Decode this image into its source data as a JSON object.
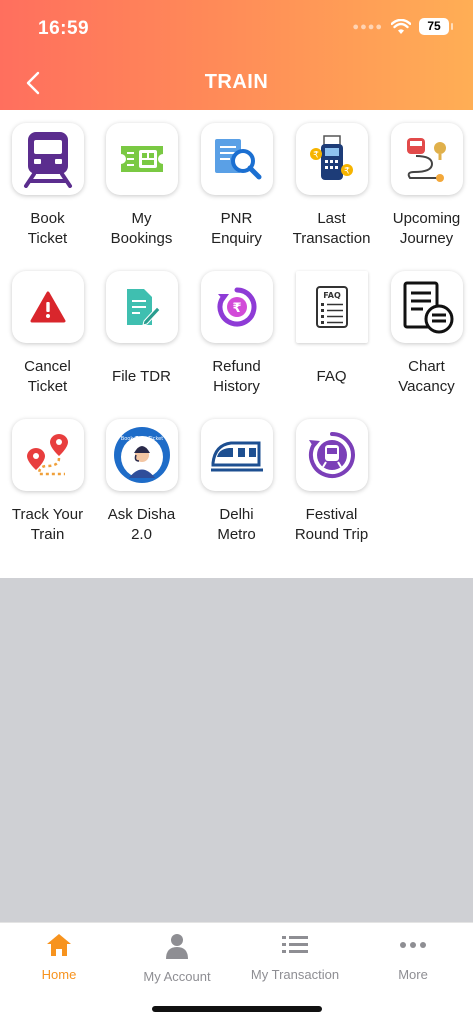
{
  "status_bar": {
    "time": "16:59",
    "battery": "75"
  },
  "header": {
    "title": "TRAIN"
  },
  "tiles": [
    {
      "label": "Book\nTicket",
      "icon": "train-front-icon"
    },
    {
      "label": "My\nBookings",
      "icon": "ticket-icon"
    },
    {
      "label": "PNR\nEnquiry",
      "icon": "pnr-search-icon"
    },
    {
      "label": "Last\nTransaction",
      "icon": "card-machine-icon"
    },
    {
      "label": "Upcoming\nJourney",
      "icon": "route-icon"
    },
    {
      "label": "Cancel\nTicket",
      "icon": "warning-icon"
    },
    {
      "label": "File TDR",
      "icon": "edit-document-icon"
    },
    {
      "label": "Refund\nHistory",
      "icon": "rupee-refresh-icon"
    },
    {
      "label": "FAQ",
      "icon": "faq-document-icon"
    },
    {
      "label": "Chart\nVacancy",
      "icon": "chart-list-icon"
    },
    {
      "label": "Track Your\nTrain",
      "icon": "location-track-icon"
    },
    {
      "label": "Ask Disha\n2.0",
      "icon": "disha-assistant-icon",
      "badge_text": "Book Train Ticket"
    },
    {
      "label": "Delhi\nMetro",
      "icon": "metro-train-icon"
    },
    {
      "label": "Festival\nRound Trip",
      "icon": "round-trip-train-icon"
    }
  ],
  "tabbar": {
    "items": [
      {
        "label": "Home",
        "icon": "home-icon",
        "active": true
      },
      {
        "label": "My Account",
        "icon": "person-icon",
        "active": false
      },
      {
        "label": "My Transaction",
        "icon": "list-icon",
        "active": false
      },
      {
        "label": "More",
        "icon": "more-dots-icon",
        "active": false
      }
    ]
  },
  "colors": {
    "accent": "#f7931e",
    "header_start": "#ff6f5e",
    "header_end": "#ffae55",
    "background": "#cfd0d4"
  }
}
